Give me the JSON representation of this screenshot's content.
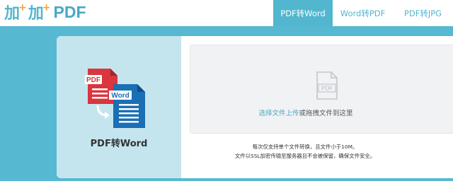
{
  "header": {
    "logo_char_1": "加",
    "logo_char_2": "加",
    "logo_text": "PDF",
    "tabs": [
      {
        "label": "PDF转Word",
        "active": true
      },
      {
        "label": "Word转PDF",
        "active": false
      },
      {
        "label": "PDF转JPG",
        "active": false
      }
    ]
  },
  "converter": {
    "title": "PDF转Word",
    "illustration": {
      "front_label": "Word",
      "back_label": "PDF"
    },
    "drop_icon_label": "PDF",
    "select_link": "选择文件上传",
    "drop_hint": "或拖拽文件到这里",
    "notes": [
      "每次仅支持单个文件转换，且文件小于10M。",
      "文件以SSL加密传输至服务器且不会被保留，确保文件安全。"
    ]
  },
  "colors": {
    "accent": "#52b6cf",
    "band": "#57b8d1",
    "pdf_red": "#d9363e",
    "word_blue": "#1a6fb5",
    "left_panel": "#c5e5ee"
  }
}
